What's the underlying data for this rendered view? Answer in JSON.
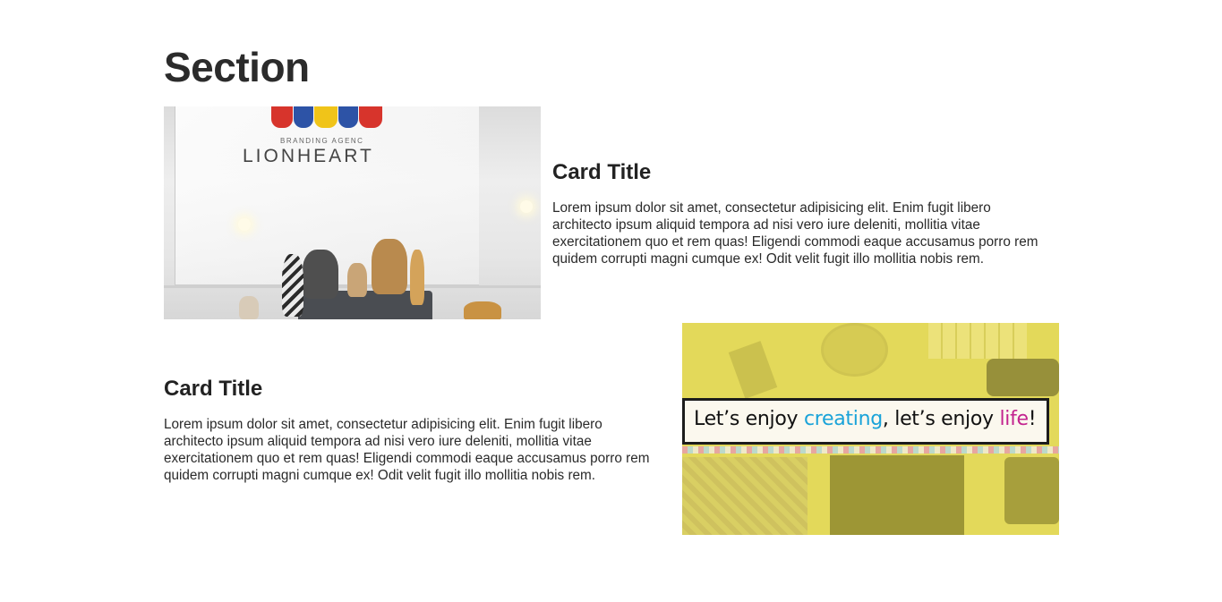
{
  "section": {
    "title": "Section"
  },
  "cards": [
    {
      "title": "Card Title",
      "text": "Lorem ipsum dolor sit amet, consectetur adipisicing elit. Enim fugit libero architecto ipsum aliquid tempora ad nisi vero iure deleniti, mollitia vitae exercitationem quo et rem quas! Eligendi commodi eaque accusamus porro rem quidem corrupti magni cumque ex! Odit velit fugit illo mollitia nobis rem.",
      "image": {
        "subject": "lionheart-branding-photo",
        "agency_text": "BRANDING AGENC",
        "brand_text": "LIONHEART"
      }
    },
    {
      "title": "Card Title",
      "text": "Lorem ipsum dolor sit amet, consectetur adipisicing elit. Enim fugit libero architecto ipsum aliquid tempora ad nisi vero iure deleniti, mollitia vitae exercitationem quo et rem quas! Eligendi commodi eaque accusamus porro rem quidem corrupti magni cumque ex! Odit velit fugit illo mollitia nobis rem.",
      "image": {
        "subject": "lets-enjoy-creating-banner",
        "banner_part1": "Let’s enjoy ",
        "banner_part2": "creating",
        "banner_part3": ", let’s enjoy ",
        "banner_part4": "life",
        "banner_part5": "!"
      }
    }
  ],
  "colors": {
    "background": "#ffffff",
    "heading": "#2b2b2b",
    "yellow_overlay": "#e3d95a",
    "accent_blue": "#1aa3d9",
    "accent_magenta": "#c3238f"
  }
}
